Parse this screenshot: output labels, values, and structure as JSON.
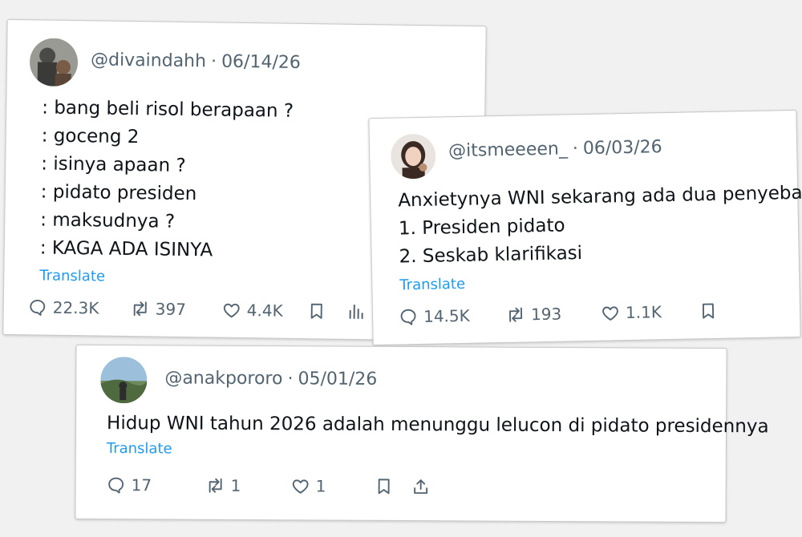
{
  "tweets": [
    {
      "handle": "@divaindahh",
      "date": "06/14/26",
      "lines": [
        ": bang beli risol berapaan ?",
        ": goceng 2",
        ": isinya apaan ?",
        ": pidato presiden",
        ": maksudnya ?",
        ": KAGA ADA ISINYA"
      ],
      "translate": "Translate",
      "replies": "22.3K",
      "retweets": "397",
      "likes": "4.4K"
    },
    {
      "handle": "@itsmeeeen_",
      "date": "06/03/26",
      "lines": [
        "Anxietynya WNI sekarang ada dua penyebab.",
        "1. Presiden pidato",
        "2. Seskab klarifikasi"
      ],
      "translate": "Translate",
      "replies": "14.5K",
      "retweets": "193",
      "likes": "1.1K"
    },
    {
      "handle": "@anakpororo",
      "date": "05/01/26",
      "lines": [
        "Hidup WNI tahun 2026 adalah menunggu lelucon di pidato presidennya"
      ],
      "translate": "Translate",
      "replies": "17",
      "retweets": "1",
      "likes": "1"
    }
  ],
  "separator": "·",
  "colors": {
    "link": "#1d9bf0",
    "muted": "#536471",
    "text": "#0f1419"
  },
  "icons": [
    "reply-icon",
    "retweet-icon",
    "like-icon",
    "bookmark-icon",
    "views-icon",
    "share-icon"
  ]
}
